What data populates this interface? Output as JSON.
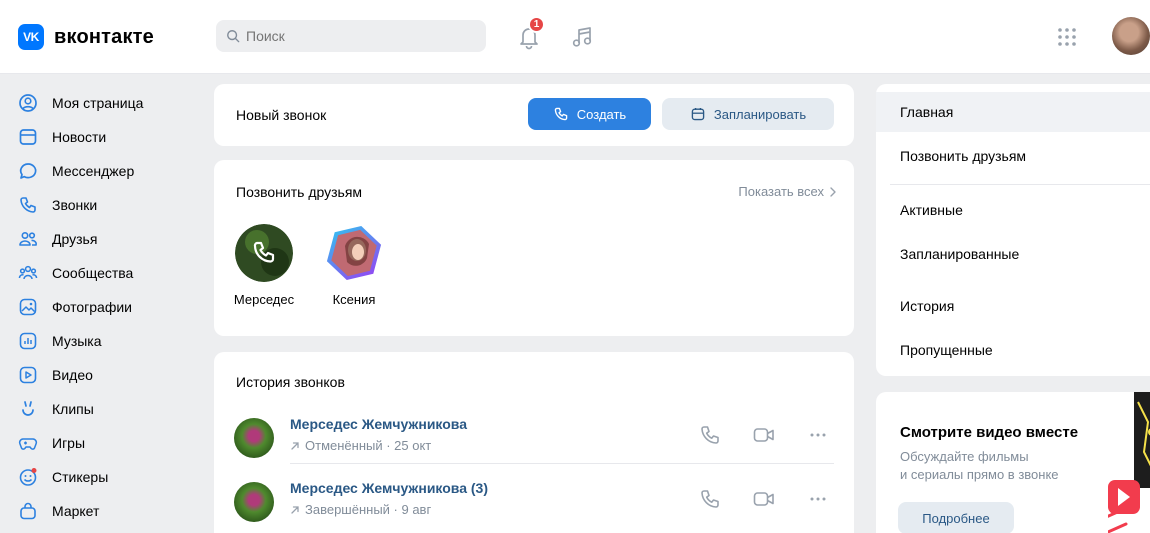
{
  "header": {
    "logo_mark": "VK",
    "logo_text": "вконтакте",
    "search_placeholder": "Поиск",
    "notifications_count": "1"
  },
  "sidebar": {
    "items": [
      {
        "label": "Моя страница",
        "icon": "user-circle-icon"
      },
      {
        "label": "Новости",
        "icon": "news-icon"
      },
      {
        "label": "Мессенджер",
        "icon": "message-bubble-icon"
      },
      {
        "label": "Звонки",
        "icon": "phone-icon"
      },
      {
        "label": "Друзья",
        "icon": "friends-icon"
      },
      {
        "label": "Сообщества",
        "icon": "communities-icon"
      },
      {
        "label": "Фотографии",
        "icon": "photos-icon"
      },
      {
        "label": "Музыка",
        "icon": "music-icon"
      },
      {
        "label": "Видео",
        "icon": "video-icon"
      },
      {
        "label": "Клипы",
        "icon": "clips-icon"
      },
      {
        "label": "Игры",
        "icon": "gamepad-icon"
      },
      {
        "label": "Стикеры",
        "icon": "stickers-icon"
      },
      {
        "label": "Маркет",
        "icon": "market-bag-icon"
      }
    ]
  },
  "new_call": {
    "title": "Новый звонок",
    "create_label": "Создать",
    "plan_label": "Запланировать"
  },
  "friends": {
    "title": "Позвонить друзьям",
    "show_all": "Показать всех",
    "items": [
      {
        "name": "Мерседес"
      },
      {
        "name": "Ксения"
      }
    ]
  },
  "history": {
    "title": "История звонков",
    "calls": [
      {
        "name": "Мерседес Жемчужникова",
        "status": "Отменённый · 25 окт"
      },
      {
        "name": "Мерседес Жемчужникова (3)",
        "status": "Завершённый · 9 авг"
      }
    ]
  },
  "right_menu": {
    "items": [
      "Главная",
      "Позвонить друзьям",
      "Активные",
      "Запланированные",
      "История",
      "Пропущенные"
    ]
  },
  "promo": {
    "title": "Смотрите видео вместе",
    "desc_line1": "Обсуждайте фильмы",
    "desc_line2": "и сериалы прямо в звонке",
    "button": "Подробнее"
  },
  "colors": {
    "accent": "#2d81e0",
    "link": "#2a5885",
    "muted": "#818c99",
    "badge": "#e64646",
    "background": "#edeef0"
  }
}
